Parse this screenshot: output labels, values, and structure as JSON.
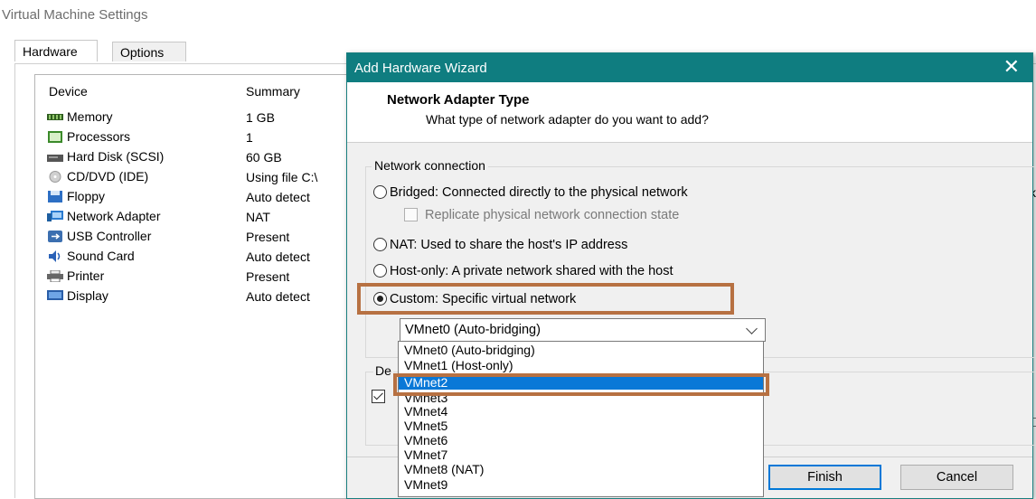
{
  "window": {
    "title": "Virtual Machine Settings"
  },
  "tabs": [
    {
      "label": "Hardware"
    },
    {
      "label": "Options"
    }
  ],
  "device_list": {
    "headers": {
      "device": "Device",
      "summary": "Summary"
    },
    "rows": [
      {
        "name": "Memory",
        "summary": "1 GB",
        "icon": "memory-icon"
      },
      {
        "name": "Processors",
        "summary": "1",
        "icon": "processor-icon"
      },
      {
        "name": "Hard Disk (SCSI)",
        "summary": "60 GB",
        "icon": "hard-disk-icon"
      },
      {
        "name": "CD/DVD (IDE)",
        "summary": "Using file C:\\",
        "icon": "cd-dvd-icon"
      },
      {
        "name": "Floppy",
        "summary": "Auto detect",
        "icon": "floppy-icon"
      },
      {
        "name": "Network Adapter",
        "summary": "NAT",
        "icon": "network-adapter-icon"
      },
      {
        "name": "USB Controller",
        "summary": "Present",
        "icon": "usb-icon"
      },
      {
        "name": "Sound Card",
        "summary": "Auto detect",
        "icon": "sound-card-icon"
      },
      {
        "name": "Printer",
        "summary": "Present",
        "icon": "printer-icon"
      },
      {
        "name": "Display",
        "summary": "Auto detect",
        "icon": "display-icon"
      }
    ]
  },
  "edge": {
    "letter": "k"
  },
  "wizard": {
    "title": "Add Hardware Wizard",
    "close": "✕",
    "header_title": "Network Adapter Type",
    "header_subtitle": "What type of network adapter do you want to add?",
    "group_label": "Network connection",
    "options": [
      {
        "label": "Bridged: Connected directly to the physical network",
        "checked": false
      },
      {
        "label": "NAT: Used to share the host's IP address",
        "checked": false
      },
      {
        "label": "Host-only: A private network shared with the host",
        "checked": false
      },
      {
        "label": "Custom: Specific virtual network",
        "checked": true
      }
    ],
    "replicate_label": "Replicate physical network connection state",
    "custom_select_value": "VMnet0 (Auto-bridging)",
    "group2_label_partial": "De",
    "finish_label": "Finish",
    "cancel_label": "Cancel"
  },
  "dropdown": {
    "items": [
      "VMnet0 (Auto-bridging)",
      "VMnet1 (Host-only)",
      "VMnet2",
      "VMnet3",
      "VMnet4",
      "VMnet5",
      "VMnet6",
      "VMnet7",
      "VMnet8 (NAT)",
      "VMnet9"
    ],
    "selected_index": 2
  },
  "colors": {
    "titlebar": "#0f7d80",
    "highlight_box": "#b77142",
    "selection": "#0a78d7"
  }
}
